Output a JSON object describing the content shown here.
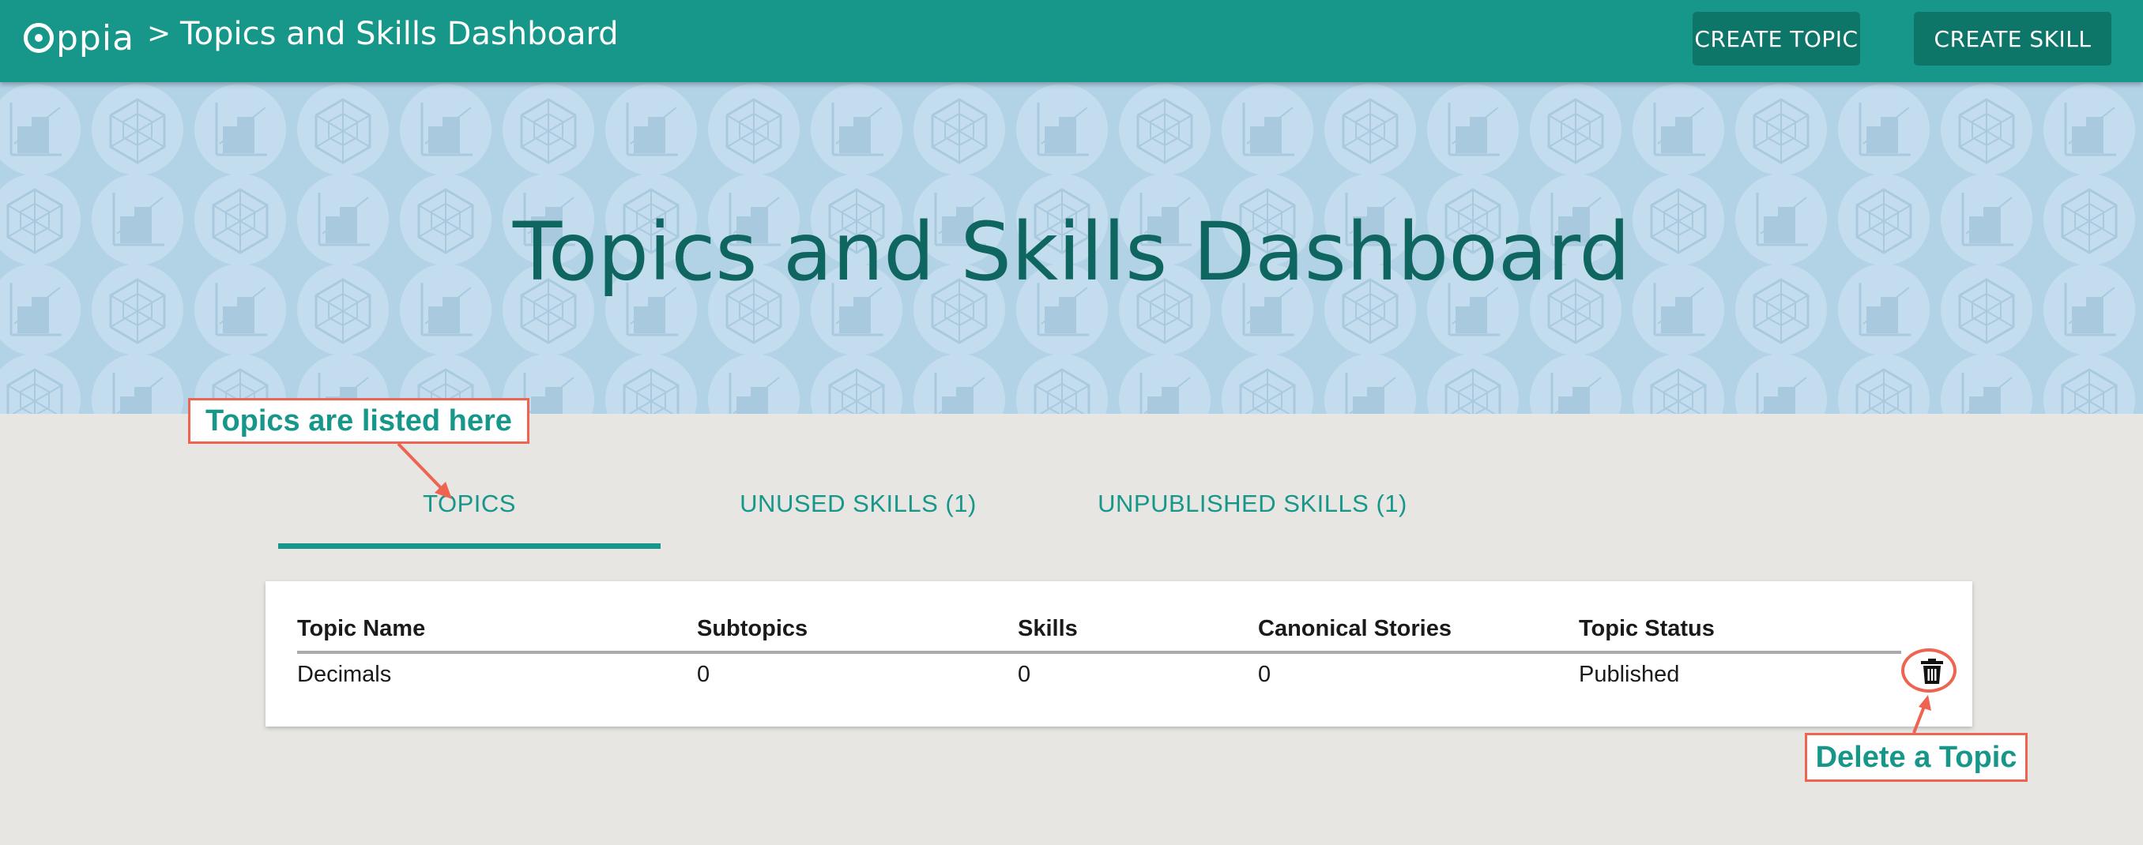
{
  "navbar": {
    "logo_text": "ppia",
    "separator": ">",
    "title": "Topics and Skills Dashboard",
    "create_topic_label": "CREATE TOPIC",
    "create_skill_label": "CREATE SKILL",
    "color": "#16978a"
  },
  "banner": {
    "title": "Topics and Skills Dashboard",
    "background_color": "#b2d2e6"
  },
  "tabs": [
    {
      "label": "TOPICS",
      "active": true
    },
    {
      "label": "UNUSED SKILLS (1)",
      "active": false
    },
    {
      "label": "UNPUBLISHED SKILLS (1)",
      "active": false
    }
  ],
  "table": {
    "columns": [
      "Topic Name",
      "Subtopics",
      "Skills",
      "Canonical Stories",
      "Topic Status"
    ],
    "rows": [
      {
        "topic_name": "Decimals",
        "subtopics": "0",
        "skills": "0",
        "canonical_stories": "0",
        "topic_status": "Published",
        "action_icon": "trash-icon"
      }
    ]
  },
  "annotations": {
    "topics_note": "Topics are listed here",
    "delete_note": "Delete a Topic",
    "color": "#ef6351"
  }
}
